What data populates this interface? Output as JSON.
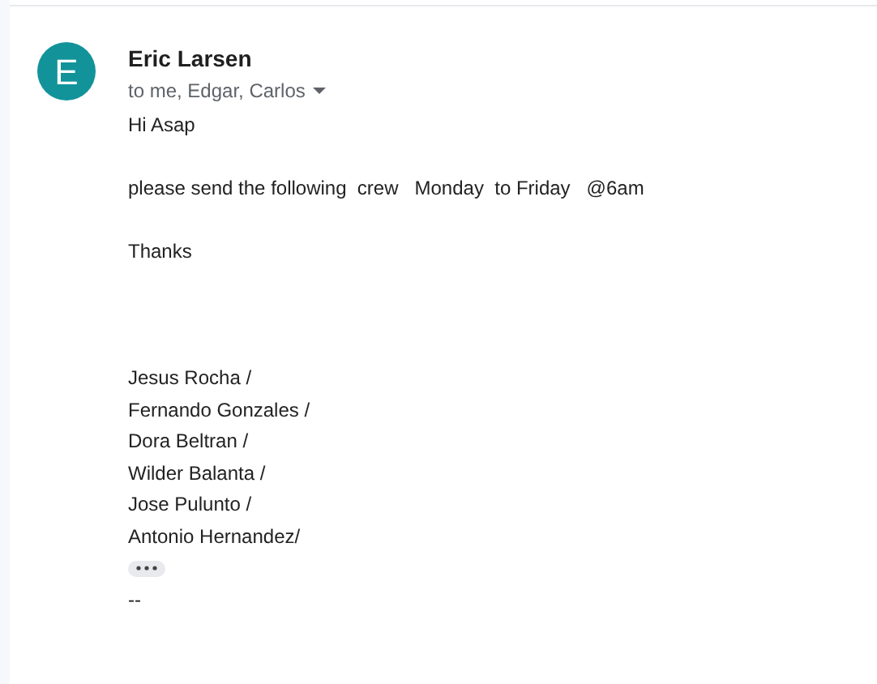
{
  "message": {
    "avatar_letter": "E",
    "sender": "Eric Larsen",
    "recipients": "to me, Edgar, Carlos",
    "body": [
      {
        "kind": "line",
        "text": "Hi Asap"
      },
      {
        "kind": "gap"
      },
      {
        "kind": "line",
        "text": "please send the following  crew   Monday  to Friday   @6am"
      },
      {
        "kind": "gap"
      },
      {
        "kind": "line",
        "text": "Thanks"
      },
      {
        "kind": "gap"
      },
      {
        "kind": "gap"
      },
      {
        "kind": "gap"
      },
      {
        "kind": "line",
        "text": "Jesus Rocha /"
      },
      {
        "kind": "line",
        "text": "Fernando Gonzales /"
      },
      {
        "kind": "line",
        "text": "Dora Beltran /"
      },
      {
        "kind": "line",
        "text": "Wilder Balanta /"
      },
      {
        "kind": "line",
        "text": "Jose Pulunto /"
      },
      {
        "kind": "line",
        "text": "Antonio Hernandez/"
      },
      {
        "kind": "more"
      },
      {
        "kind": "line",
        "text": "--"
      }
    ]
  }
}
